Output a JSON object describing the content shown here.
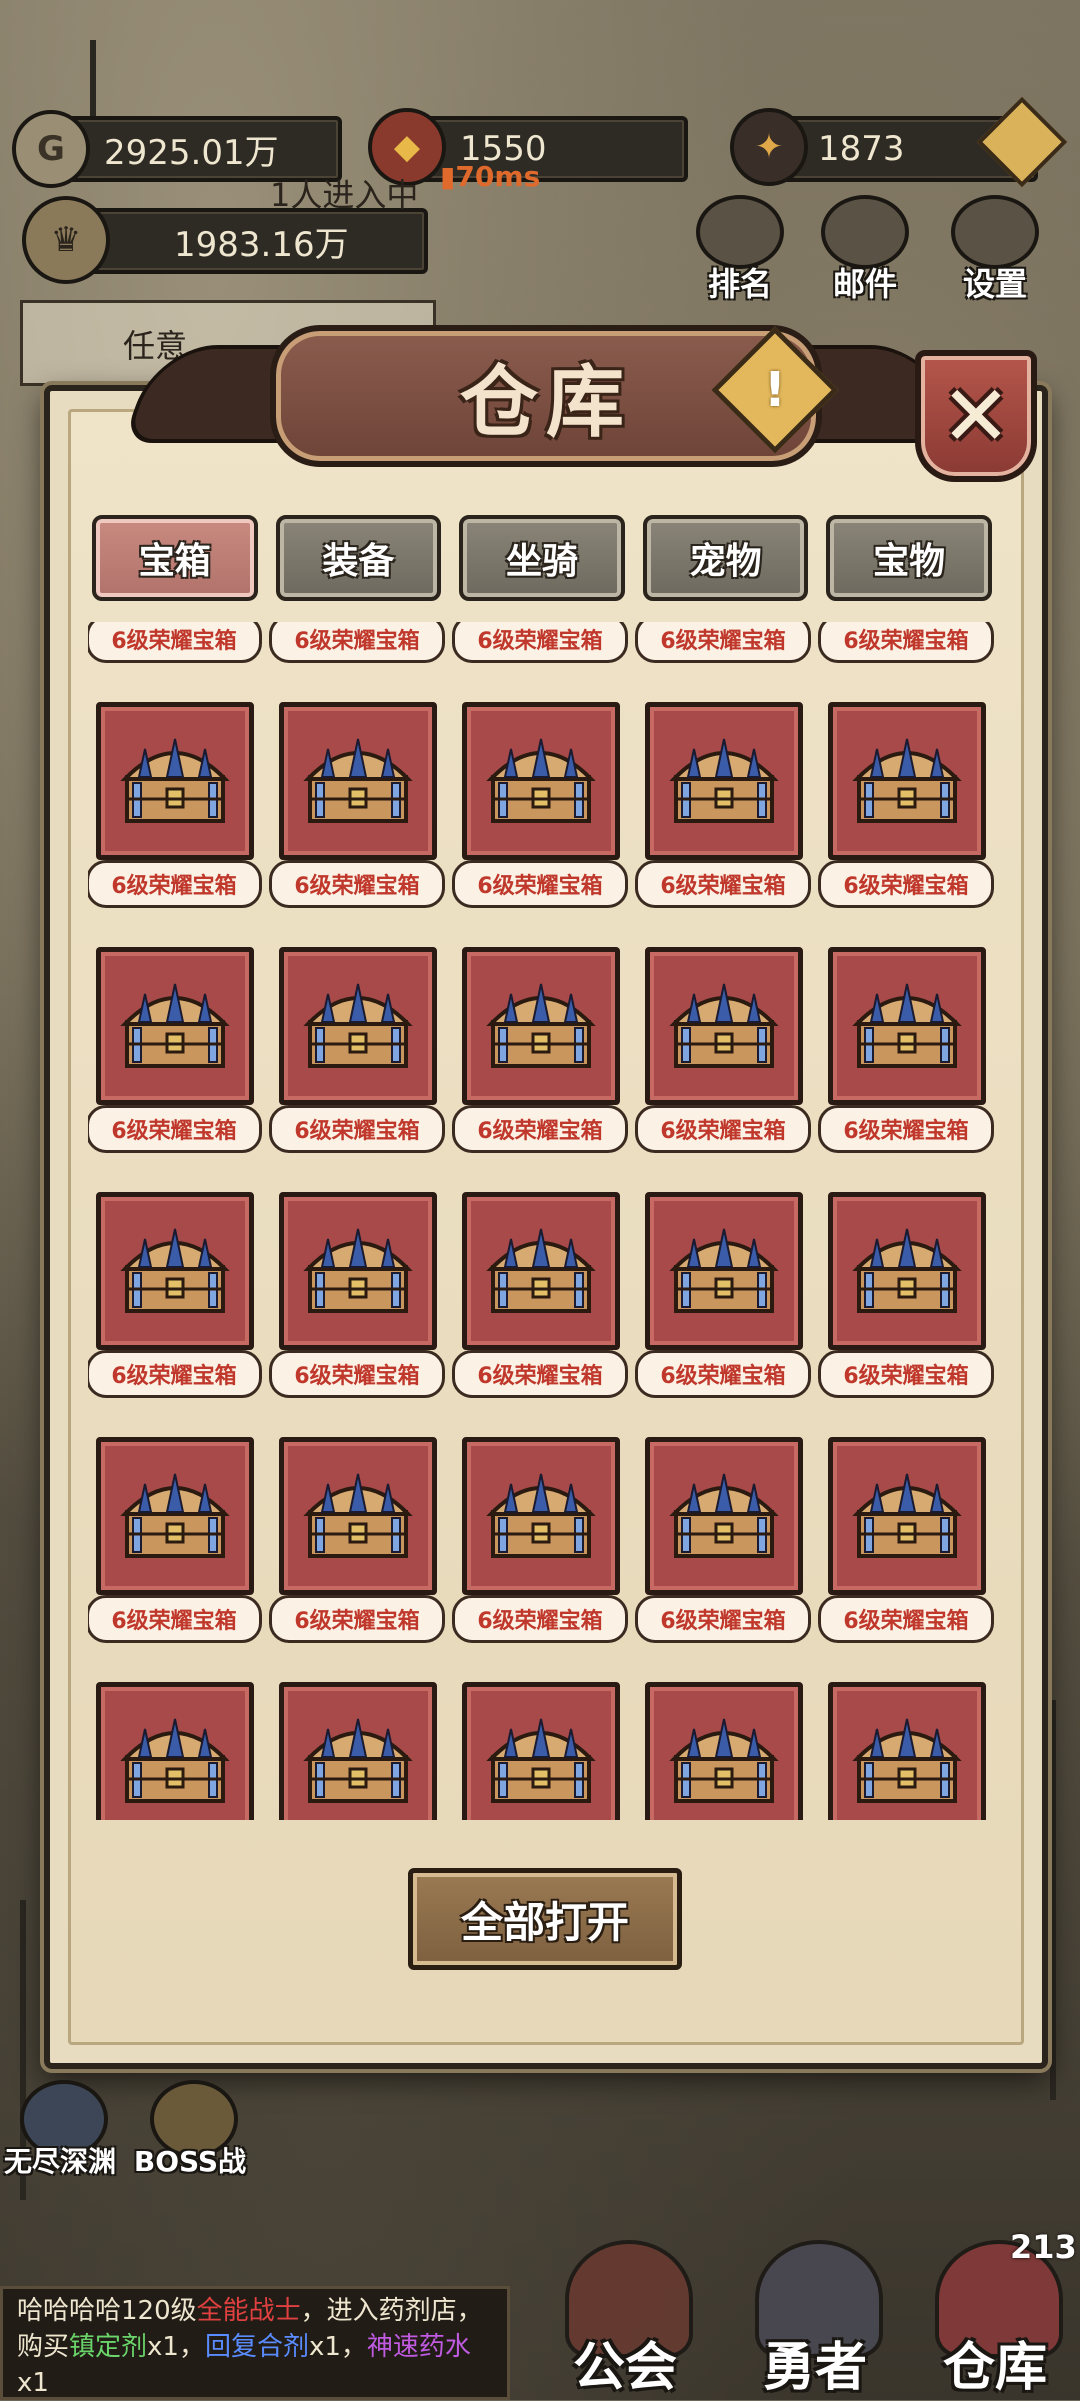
{
  "hud": {
    "gold": "2925.01万",
    "gem": "1550",
    "energy": "1873",
    "power": "1983.16万",
    "ping": "70ms",
    "behind_text": "1人进入中",
    "task_text": "任意",
    "buttons": [
      "排名",
      "邮件",
      "设置"
    ]
  },
  "dialog": {
    "title": "仓库",
    "info_glyph": "!",
    "close_glyph": "✕",
    "tabs": [
      {
        "label": "宝箱",
        "active": true
      },
      {
        "label": "装备",
        "active": false
      },
      {
        "label": "坐骑",
        "active": false
      },
      {
        "label": "宠物",
        "active": false
      },
      {
        "label": "宝物",
        "active": false
      }
    ],
    "item_label": "6级荣耀宝箱",
    "open_all": "全部打开"
  },
  "bottom": {
    "side_buttons": [
      "无尽深渊",
      "BOSS战"
    ],
    "nav": [
      "公会",
      "勇者",
      "仓库"
    ],
    "nav_badge": "213",
    "chat": {
      "part1": "哈哈哈哈120级",
      "name": "全能战士",
      "part2": "，进入药剂店，购买",
      "item1": "镇定剂",
      "x1": "x1，",
      "item2": "回复合剂",
      "x2": "x1，",
      "item3": "神速药水",
      "x3": "x1"
    }
  },
  "colors": {
    "item_bg": "#a84a4a",
    "label_text": "#c0382c",
    "active_tab": "#c98a80",
    "inactive_tab": "#7a7568",
    "panel": "#e8dcc0"
  }
}
